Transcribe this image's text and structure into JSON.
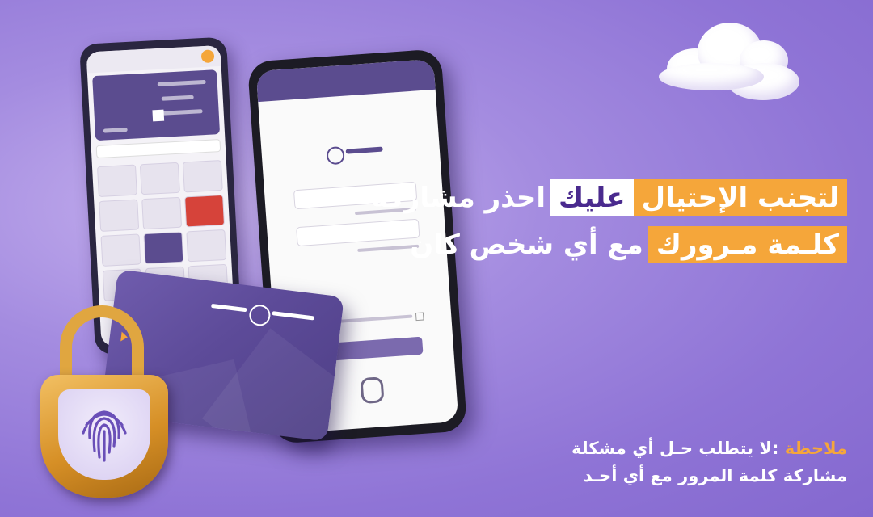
{
  "headline": {
    "line1": [
      "لتجنب الإحتيال",
      "عليك",
      "احذر مشاركة"
    ],
    "line2": [
      "كلـمة مـرورك",
      "مع أي شخص كان"
    ]
  },
  "note": {
    "prefix": "ملاحظة",
    "line1": ":لا يتطلب حـل أي مشكلة",
    "line2": "مشاركة كلمة المرور مع أي أحـد"
  },
  "colors": {
    "accent": "#f5a63a",
    "brand": "#5b4c8f",
    "background": "#9a82dc"
  }
}
